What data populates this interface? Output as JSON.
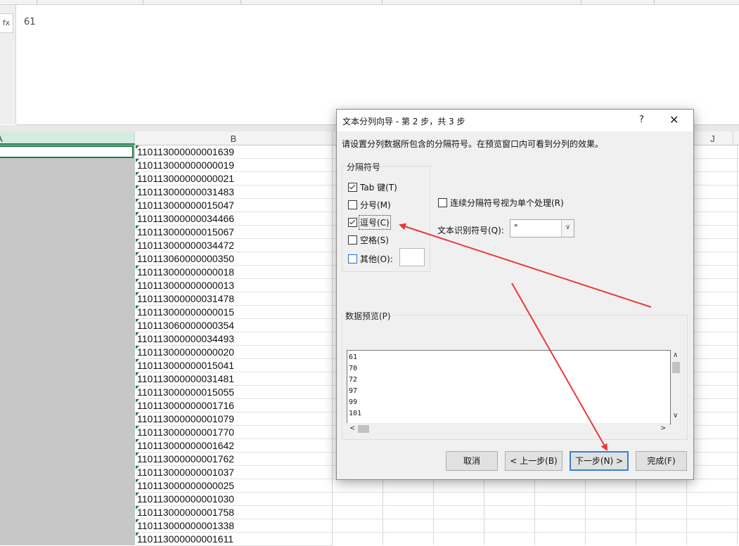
{
  "formula_bar": {
    "fx_label": "fx",
    "value": "61"
  },
  "columns": {
    "a": "A",
    "b": "B",
    "j": "J"
  },
  "column_b_values": [
    "110113000000001639",
    "110113000000000019",
    "110113000000000021",
    "110113000000031483",
    "110113000000015047",
    "110113000000034466",
    "110113000000015067",
    "110113000000034472",
    "110113060000000350",
    "110113000000000018",
    "110113000000000013",
    "110113000000031478",
    "110113000000000015",
    "110113060000000354",
    "110113000000034493",
    "110113000000000020",
    "110113000000015041",
    "110113000000031481",
    "110113000000015055",
    "110113000000001716",
    "110113000000001079",
    "110113000000001770",
    "110113000000001642",
    "110113000000001762",
    "110113000000001037",
    "110113000000000025",
    "110113000000001030",
    "110113000000001758",
    "110113000000001338",
    "110113000000001611"
  ],
  "dialog": {
    "title": "文本分列向导 - 第 2 步，共 3 步",
    "help": "?",
    "close": "✕",
    "description": "请设置分列数据所包含的分隔符号。在预览窗口内可看到分列的效果。",
    "delimiters_title": "分隔符号",
    "delimiters": [
      {
        "label": "Tab 键(T)",
        "checked": true
      },
      {
        "label": "分号(M)",
        "checked": false
      },
      {
        "label": "逗号(C)",
        "checked": true
      },
      {
        "label": "空格(S)",
        "checked": false
      },
      {
        "label": "其他(O):",
        "checked": false
      }
    ],
    "consecutive_label": "连续分隔符号视为单个处理(R)",
    "consecutive_checked": false,
    "text_qualifier_label": "文本识别符号(Q):",
    "text_qualifier_value": "\"",
    "preview_title": "数据预览(P)",
    "preview_rows": [
      "61",
      "70",
      "72",
      "97",
      "99",
      "101"
    ],
    "buttons": {
      "cancel": "取消",
      "back": "< 上一步(B)",
      "next": "下一步(N) >",
      "finish": "完成(F)"
    }
  },
  "colors": {
    "annotation_arrow": "#e8383d",
    "selection_green": "#1f7a4a",
    "focus_blue": "#3b7fd0"
  }
}
